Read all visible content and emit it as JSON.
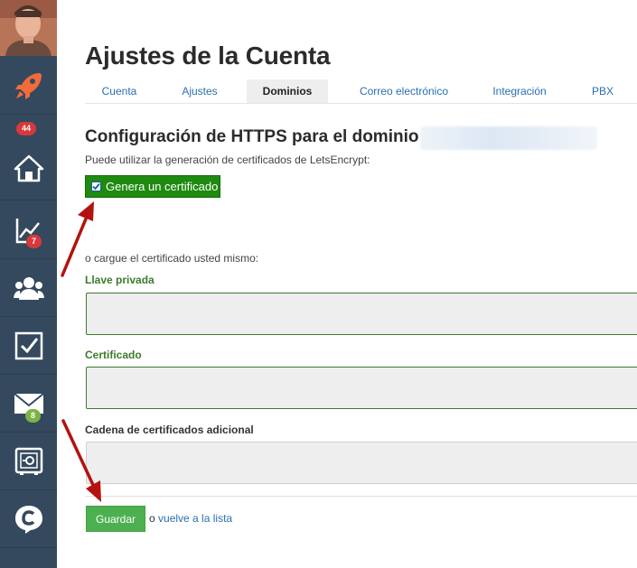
{
  "sidebar": {
    "badges": {
      "rocket_count": "44",
      "analytics_count": "7",
      "mail_count": "8"
    }
  },
  "page": {
    "title": "Ajustes de la Cuenta",
    "tabs": [
      {
        "label": "Cuenta"
      },
      {
        "label": "Ajustes"
      },
      {
        "label": "Dominios",
        "active": true
      },
      {
        "label": "Correo electrónico"
      },
      {
        "label": "Integración"
      },
      {
        "label": "PBX"
      }
    ]
  },
  "https": {
    "heading": "Configuración de HTTPS para el dominio",
    "hint": "Puede utilizar la generación de certificados de LetsEncrypt:",
    "generate_label": "Genera un certificado",
    "generate_checked": true,
    "upload_hint": "o cargue el certificado usted mismo:",
    "private_key_label": "Llave privada",
    "certificate_label": "Certificado",
    "chain_label": "Cadena de certificados adicional"
  },
  "actions": {
    "save_label": "Guardar",
    "or_text": "o",
    "back_link": "vuelve a la lista"
  },
  "colors": {
    "sidebar_bg": "#34495e",
    "generate_btn": "#1e8a0f",
    "save_btn": "#4cb050",
    "link": "#2a6fb0",
    "annotation_arrow": "#b3120f"
  }
}
